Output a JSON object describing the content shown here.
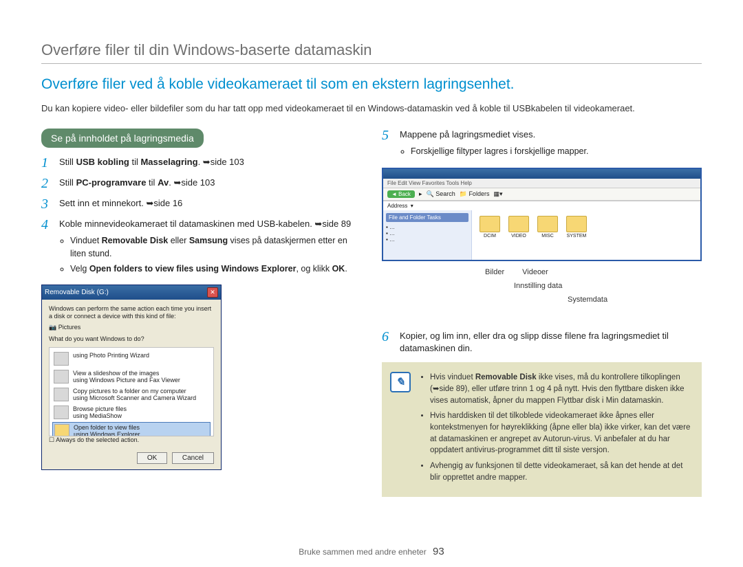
{
  "page_title": "Overføre filer til din Windows-baserte datamaskin",
  "section_title": "Overføre filer ved å koble videokameraet til som en ekstern lagringsenhet.",
  "intro": "Du kan kopiere video- eller bildefiler som du har tatt opp med videokameraet til en Windows-datamaskin ved å koble til USBkabelen til videokameraet.",
  "pill": "Se på innholdet på lagringsmedia",
  "steps_left": {
    "s1": {
      "pre": "Still ",
      "b1": "USB kobling",
      "mid": " til ",
      "b2": "Masselagring",
      "post": ". ",
      "ref": "side 103"
    },
    "s2": {
      "pre": "Still ",
      "b1": "PC-programvare",
      "mid": " til ",
      "b2": "Av",
      "post": ". ",
      "ref": "side 103"
    },
    "s3": {
      "text": "Sett inn et minnekort. ",
      "ref": "side 16"
    },
    "s4": {
      "text": "Koble minnevideokameraet til datamaskinen med USB-kabelen. ",
      "ref": "side 89"
    },
    "s4b1": {
      "pre": "Vinduet ",
      "b1": "Removable Disk",
      "mid": " eller ",
      "b2": "Samsung",
      "post": " vises på dataskjermen etter en liten stund."
    },
    "s4b2": {
      "pre": "Velg ",
      "b1": "Open folders to view files using Windows Explorer",
      "mid": ", og klikk ",
      "b2": "OK",
      "post": "."
    }
  },
  "steps_right": {
    "s5": {
      "text": "Mappene på lagringsmediet vises."
    },
    "s5b1": "Forskjellige filtyper lagres i forskjellige mapper.",
    "s6": {
      "text": "Kopier, og lim inn, eller dra og slipp disse filene fra lagringsmediet til datamaskinen din."
    }
  },
  "dialog": {
    "title": "Removable Disk (G:)",
    "desc": "Windows can perform the same action each time you insert a disk or connect a device with this kind of file:",
    "pictures": "Pictures",
    "prompt": "What do you want Windows to do?",
    "opts": [
      {
        "t": "using Photo Printing Wizard"
      },
      {
        "t": "View a slideshow of the images",
        "s": "using Windows Picture and Fax Viewer"
      },
      {
        "t": "Copy pictures to a folder on my computer",
        "s": "using Microsoft Scanner and Camera Wizard"
      },
      {
        "t": "Browse picture files",
        "s": "using MediaShow"
      },
      {
        "t": "Open folder to view files",
        "s": "using Windows Explorer"
      }
    ],
    "always": "Always do the selected action.",
    "ok": "OK",
    "cancel": "Cancel"
  },
  "explorer": {
    "menu": "File  Edit  View  Favorites  Tools  Help",
    "back": "Back",
    "search": "Search",
    "folders": "Folders",
    "address": "Address",
    "task_title": "File and Folder Tasks",
    "folders_list": [
      "DCIM",
      "VIDEO",
      "MISC",
      "SYSTEM"
    ]
  },
  "callouts": {
    "bilder": "Bilder",
    "videoer": "Videoer",
    "innstilling": "Innstilling data",
    "systemdata": "Systemdata"
  },
  "note": {
    "b1": {
      "pre": "Hvis vinduet ",
      "b": "Removable Disk",
      "post": " ikke vises, må du kontrollere tilkoplingen (➥side 89), eller utføre trinn 1 og 4 på nytt. Hvis den flyttbare disken ikke vises automatisk, åpner du mappen Flyttbar disk i Min datamaskin."
    },
    "b2": "Hvis harddisken til det tilkoblede videokameraet ikke åpnes eller kontekstmenyen for høyreklikking (åpne eller bla) ikke virker, kan det være at datamaskinen er angrepet av Autorun-virus. Vi anbefaler at du har oppdatert antivirus-programmet ditt til siste versjon.",
    "b3": "Avhengig av funksjonen til dette videokameraet, så kan det hende at det blir opprettet andre mapper."
  },
  "footer": {
    "chapter": "Bruke sammen med andre enheter",
    "page": "93"
  }
}
